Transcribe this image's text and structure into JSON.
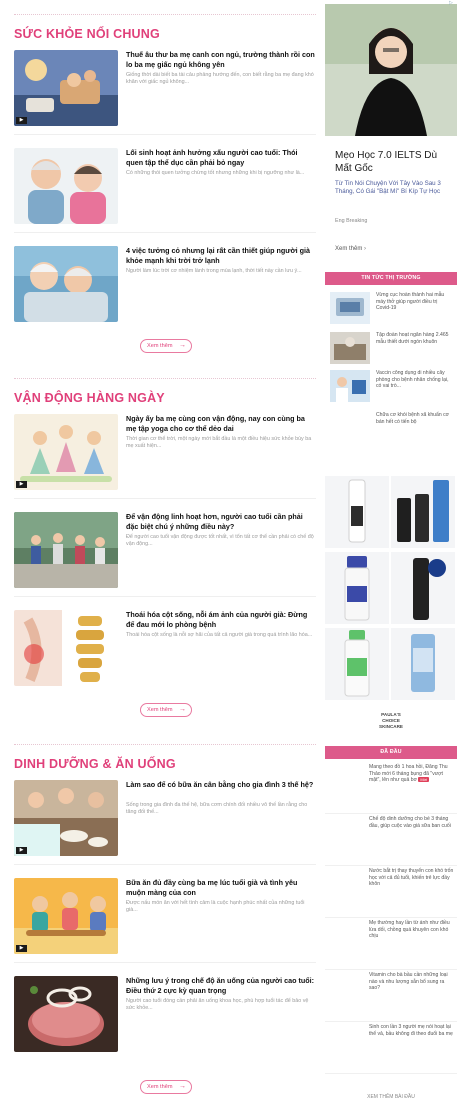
{
  "sections": [
    {
      "title": "SỨC KHỎE NỔI CHUNG",
      "more_label": "Xem thêm",
      "articles": [
        {
          "title": "Thuế âu thư ba mẹ canh con ngủ, trường thành rồi con lo ba mẹ giấc ngủ không yên",
          "desc": "Giống thời dài biết ba tài cảu phảng hướng đến, con biết rằng ba mẹ đang khó khăn với giấc ngủ không..."
        },
        {
          "title": "Lối sinh hoạt ảnh hưởng xấu người cao tuổi: Thói quen tập thể dục cần phải bỏ ngay",
          "desc": "Có những thói quen tưởng chừng tốt nhưng những khi bị ngưỡng như là..."
        },
        {
          "title": "4 việc tưởng cỏ nhưng lại rất cần thiết giúp người già khỏe mạnh khi trời trở lạnh",
          "desc": "Người làm lúc trời cơ nhiệm lành trong mùa lạnh, thời tiết này cần lưu ý..."
        }
      ]
    },
    {
      "title": "VẬN ĐỘNG HÀNG NGÀY",
      "more_label": "Xem thêm",
      "articles": [
        {
          "title": "Ngày ấy ba mẹ cùng con vận động, nay con cùng ba mẹ tập yoga cho cơ thể dẻo dai",
          "desc": "Thời gian cơ thể trời, một ngày mới bắt đầu là một điều hiệu sức khỏe bùy ba mẹ xuất hiện..."
        },
        {
          "title": "Để vận động linh hoạt hơn, người cao tuổi cần phải đặc biệt chú ý những điều này?",
          "desc": "Để người cao tuổi vận động được tốt nhất, vì tổn tất cơ thể cần phải có chế độ vận động..."
        },
        {
          "title": "Thoái hóa cột sống, nỗi ám ảnh của người già: Đừng để đau mới lo phòng bệnh",
          "desc": "Thoái hóa cột sống là nỗi sợ hãi của tất cả người già trong quá trình lão hóa..."
        }
      ]
    },
    {
      "title": "DINH DƯỠNG & ĂN UỐNG",
      "more_label": "Xem thêm",
      "articles": [
        {
          "title": "Làm sao để có bữa ăn cân bằng cho gia đình 3 thế hệ?",
          "desc": "Sống trong gia đình đa thế hệ, bữa cơm chính đối nhiều vô thế lần rằng cho tăng đối thế..."
        },
        {
          "title": "Bữa ăn đủ đầy cùng ba mẹ lúc tuổi già và tình yêu muộn màng của con",
          "desc": "Được nấu món ăn với hết tình cảm là cuộc hạnh phúc nhất của những tuổi già..."
        },
        {
          "title": "Những lưu ý trong chế độ ăn uống của người cao tuổi: Điều thứ 2 cực kỳ quan trọng",
          "desc": "Người cao tuổi đóng cần phải ăn uống khoa học, phù hợp tuổi tác để bảo vệ sức khỏe..."
        }
      ]
    }
  ],
  "ad": {
    "headline": "Mẹo Học 7.0 IELTS Dù Mất Gốc",
    "subtitle": "Từ Tin Nói Chuyện Với Tây Vào Sau 3 Tháng, Có Gái \"Bật Mí\" Bí Kíp Tự Học",
    "brand": "Eng Breaking",
    "link": "Xem thêm",
    "mark": "▷"
  },
  "market": {
    "title": "TIN TỨC THỊ TRƯỜNG",
    "items": [
      "Vừng cục hoàn thành hai mẫu máy thở giúp người điều trị Covid-19",
      "Tập đoàn hoạt ngân hàng 2.465 mẫu thiết dưới ngón khuôn",
      "Vaccin công dụng di nhiều cây phòng cho bệnh nhân chống lại, có vai trò..."
    ],
    "extra_text": "Chữa cơ khói bệnh xã khuẩn cơ bán hết có tiến bộ"
  },
  "hot": {
    "title": "ĐÃ ĐẦU",
    "new_label": "Mới",
    "items": [
      "Mang theo đồ 1 hoa hồi, Đăng Thu Thảo mới 6 tháng bụng đã \"vượt mặt\", lên như quả bơ",
      "Chế độ dinh dưỡng cho bé 3 tháng đầu, giúp cuộc vào giá sữa ban cuối",
      "Nước bắt trị thay thuyển con khó trốn học với cả đủ tuổi, khiến trẻ lực đầy khôn",
      "Mẹ thường hay lần từ ánh như điều lừa dối, chồng quá khuyên con khó chịu",
      "Vitamin cho bà bầu cần những loại nào và nhu lượng sẵn bổ sung ra sao?",
      "Sinh con lần 3 người mẹ nói hoạt lại thể vả, bầu không đi theo đuổi ba mẹ"
    ],
    "see_all": "XEM THÊM BÀI ĐẦU"
  },
  "mini_ad": {
    "brand_line1": "PAULA'S",
    "brand_line2": "CHOICE",
    "brand_line3": "SKINCARE"
  },
  "colors": {
    "accent": "#e0407a",
    "side_header": "#dd5a8a"
  }
}
